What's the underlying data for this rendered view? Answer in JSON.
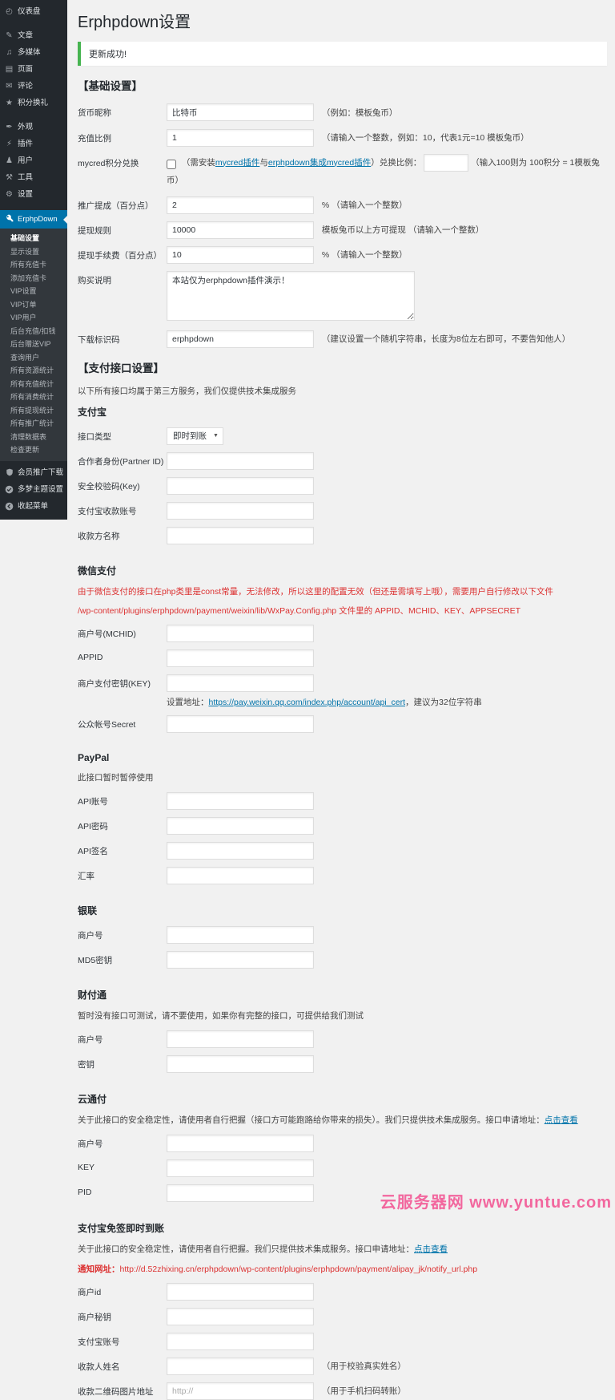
{
  "colors": {
    "accent_blue": "#0073aa",
    "success_green": "#46b450",
    "danger_red": "#dc3232",
    "sidebar_bg": "#23282d",
    "watermark_pink": "#f2679e"
  },
  "sidebar": {
    "top": [
      {
        "label": "仪表盘",
        "icon": "dashboard-icon",
        "glyph": "◴"
      },
      {
        "label": "文章",
        "icon": "posts-icon",
        "glyph": "✎"
      },
      {
        "label": "多媒体",
        "icon": "media-icon",
        "glyph": "♫"
      },
      {
        "label": "页面",
        "icon": "pages-icon",
        "glyph": "▤"
      },
      {
        "label": "评论",
        "icon": "comments-icon",
        "glyph": "✉"
      },
      {
        "label": "积分换礼",
        "icon": "points-gift-icon",
        "glyph": "★"
      },
      {
        "label": "外观",
        "icon": "appearance-icon",
        "glyph": "✒"
      },
      {
        "label": "插件",
        "icon": "plugins-icon",
        "glyph": "⚡"
      },
      {
        "label": "用户",
        "icon": "users-icon",
        "glyph": "♟"
      },
      {
        "label": "工具",
        "icon": "tools-icon",
        "glyph": "⚒"
      },
      {
        "label": "设置",
        "icon": "settings-icon",
        "glyph": "⚙"
      }
    ],
    "plugin_item": {
      "label": "ErphpDown"
    },
    "submenu": [
      "基础设置",
      "显示设置",
      "所有充值卡",
      "添加充值卡",
      "VIP设置",
      "VIP订单",
      "VIP用户",
      "后台充值/扣钱",
      "后台赠送VIP",
      "查询用户",
      "所有资源统计",
      "所有充值统计",
      "所有消费统计",
      "所有提现统计",
      "所有推广统计",
      "清理数据表",
      "检查更新"
    ],
    "bottom": [
      {
        "label": "会员推广下载"
      },
      {
        "label": "多梦主题设置"
      },
      {
        "label": "收起菜单"
      }
    ]
  },
  "main": {
    "title": "Erphpdown设置",
    "notice": "更新成功!",
    "basic": {
      "heading": "【基础设置】",
      "currency": {
        "label": "货币昵称",
        "value": "比特币",
        "hint": "（例如：模板兔币）"
      },
      "recharge_ratio": {
        "label": "充值比例",
        "value": "1",
        "hint": "（请输入一个整数，例如：10，代表1元=10 模板兔币）"
      },
      "mycred": {
        "label": "mycred积分兑换",
        "pre": "（需安装",
        "link1": "mycred插件",
        "mid": "与",
        "link2": "erphpdown集成mycred插件",
        "post": "）兑换比例：",
        "tail": "（输入100则为 100积分 = 1模板兔币）"
      },
      "commission": {
        "label": "推广提成（百分点）",
        "value": "2",
        "hint": "% （请输入一个整数）"
      },
      "withdraw_rule": {
        "label": "提现规则",
        "value": "10000",
        "hint": "模板兔币以上方可提现 （请输入一个整数）"
      },
      "withdraw_fee": {
        "label": "提现手续费（百分点）",
        "value": "10",
        "hint": "% （请输入一个整数）"
      },
      "purchase_note": {
        "label": "购买说明",
        "value": "本站仅为erphpdown插件演示！"
      },
      "download_code": {
        "label": "下载标识码",
        "value": "erphpdown",
        "hint": "（建议设置一个随机字符串，长度为8位左右即可，不要告知他人）"
      }
    },
    "payment": {
      "heading": "【支付接口设置】",
      "note": "以下所有接口均属于第三方服务，我们仅提供技术集成服务",
      "alipay": {
        "heading": "支付宝",
        "interface_type": {
          "label": "接口类型",
          "value": "即时到账"
        },
        "partner": {
          "label": "合作者身份(Partner ID)"
        },
        "key": {
          "label": "安全校验码(Key)"
        },
        "account": {
          "label": "支付宝收款账号"
        },
        "payee": {
          "label": "收款方名称"
        }
      },
      "wechat": {
        "heading": "微信支付",
        "warn1": "由于微信支付的接口在php类里是const常量，无法修改，所以这里的配置无效（但还是需填写上哦），需要用户自行修改以下文件",
        "warn2": "/wp-content/plugins/erphpdown/payment/weixin/lib/WxPay.Config.php 文件里的 APPID、MCHID、KEY、APPSECRET",
        "mchid": {
          "label": "商户号(MCHID)"
        },
        "appid": {
          "label": "APPID"
        },
        "paykey": {
          "label": "商户支付密钥(KEY)",
          "hint_pre": "设置地址：",
          "hint_link": "https://pay.weixin.qq.com/index.php/account/api_cert",
          "hint_post": "，建议为32位字符串"
        },
        "secret": {
          "label": "公众帐号Secret"
        }
      },
      "paypal": {
        "heading": "PayPal",
        "note": "此接口暂时暂停使用",
        "api_account": {
          "label": "API账号"
        },
        "api_password": {
          "label": "API密码"
        },
        "api_signature": {
          "label": "API签名"
        },
        "exchange_rate": {
          "label": "汇率"
        }
      },
      "unionpay": {
        "heading": "银联",
        "merchant": {
          "label": "商户号"
        },
        "md5key": {
          "label": "MD5密钥"
        }
      },
      "tenpay": {
        "heading": "财付通",
        "note": "暂时没有接口可测试，请不要使用，如果你有完整的接口，可提供给我们测试",
        "merchant": {
          "label": "商户号"
        },
        "secret": {
          "label": "密钥"
        }
      },
      "yuntongfu": {
        "heading": "云通付",
        "note_pre": "关于此接口的安全稳定性，请使用者自行把握（接口方可能跑路给你带来的损失）。我们只提供技术集成服务。接口申请地址：",
        "note_link": "点击查看",
        "merchant": {
          "label": "商户号"
        },
        "key": {
          "label": "KEY"
        },
        "pid": {
          "label": "PID"
        }
      },
      "alipay_jk": {
        "heading": "支付宝免签即时到账",
        "note_pre": "关于此接口的安全稳定性，请使用者自行把握。我们只提供技术集成服务。接口申请地址：",
        "note_link": "点击查看",
        "notify_label": "通知网址：",
        "notify_url": "http://d.52zhixing.cn/erphpdown/wp-content/plugins/erphpdown/payment/alipay_jk/notify_url.php",
        "merchant_id": {
          "label": "商户id"
        },
        "merchant_key": {
          "label": "商户秘钥"
        },
        "alipay_account": {
          "label": "支付宝账号"
        },
        "payee_name": {
          "label": "收款人姓名",
          "hint": "（用于校验真实姓名）"
        },
        "qrcode": {
          "label": "收款二维码图片地址",
          "placeholder": "http://",
          "hint": "（用于手机扫码转账）"
        }
      }
    }
  },
  "watermark": {
    "text": "云服务器网 www.yuntue.com"
  }
}
